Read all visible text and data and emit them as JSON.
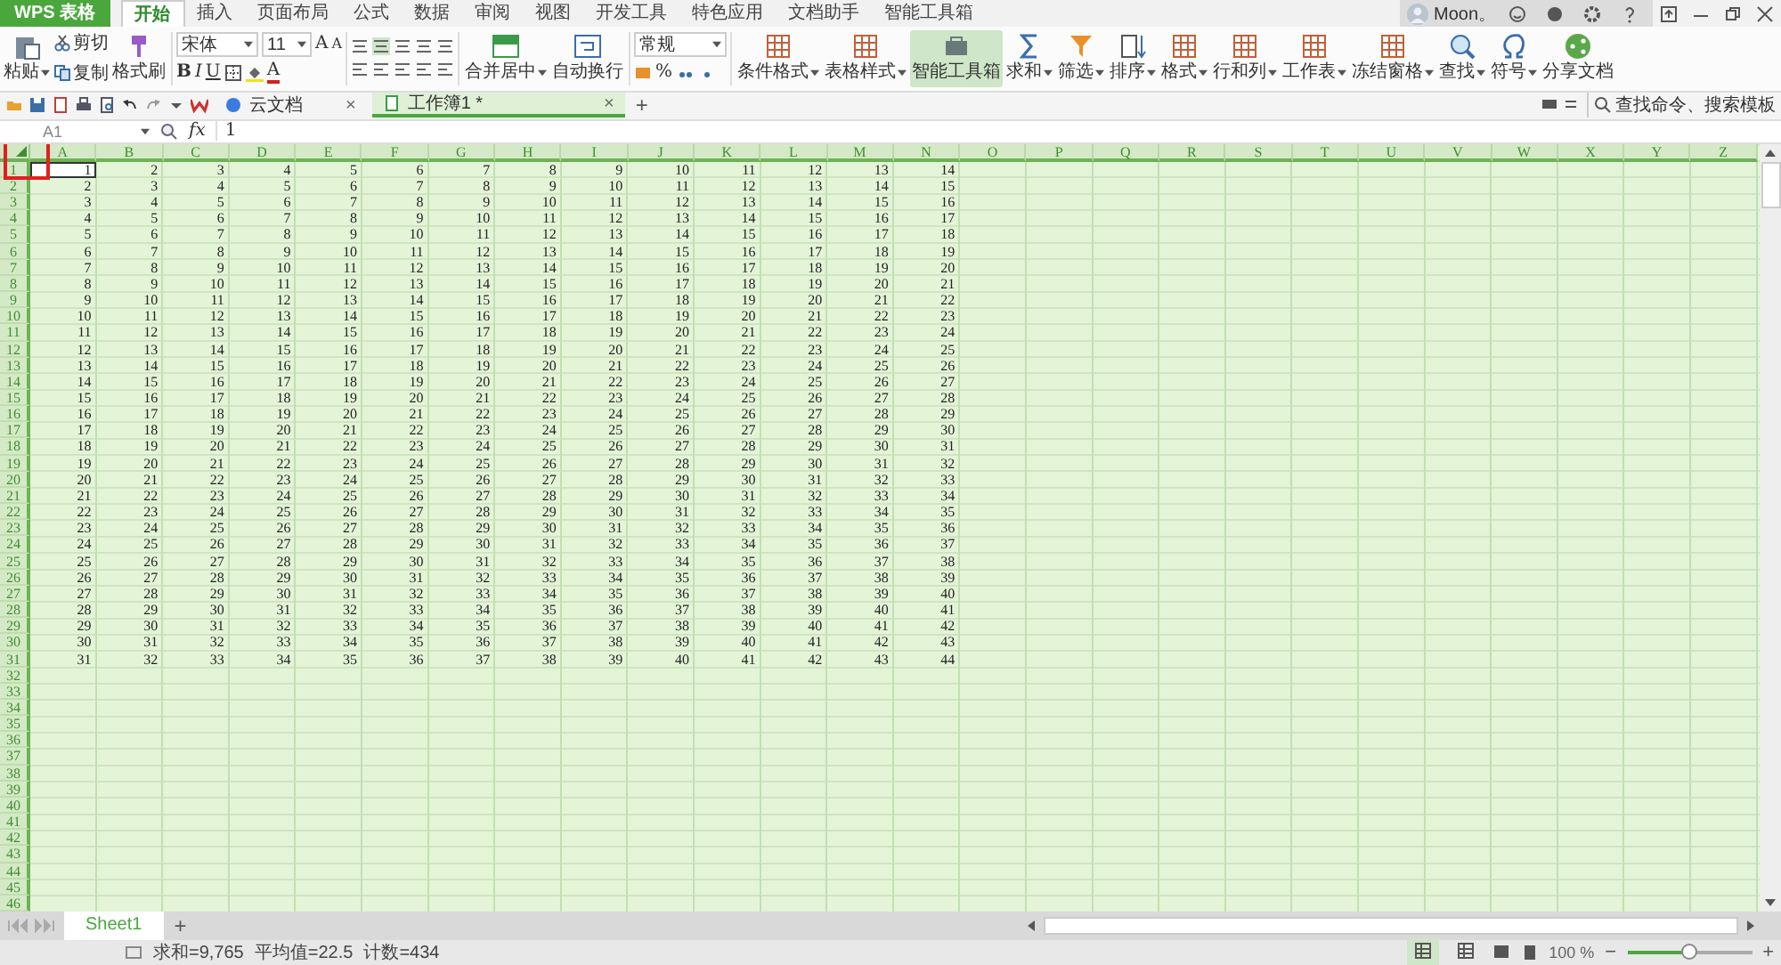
{
  "app_button": {
    "label": "WPS 表格"
  },
  "menu_tabs": [
    {
      "label": "开始",
      "selected": true
    },
    {
      "label": "插入",
      "selected": false
    },
    {
      "label": "页面布局",
      "selected": false
    },
    {
      "label": "公式",
      "selected": false
    },
    {
      "label": "数据",
      "selected": false
    },
    {
      "label": "审阅",
      "selected": false
    },
    {
      "label": "视图",
      "selected": false
    },
    {
      "label": "开发工具",
      "selected": false
    },
    {
      "label": "特色应用",
      "selected": false
    },
    {
      "label": "文档助手",
      "selected": false
    },
    {
      "label": "智能工具箱",
      "selected": false
    }
  ],
  "user": {
    "name": "Moon。"
  },
  "ribbon": {
    "paste": "粘贴",
    "cut": "剪切",
    "copy": "复制",
    "format_painter": "格式刷",
    "font": {
      "name": "宋体",
      "size": "11",
      "grow": "A",
      "shrink": "A",
      "bold": "B",
      "italic": "I",
      "underline": "U",
      "font_color": "A"
    },
    "merge": "合并居中",
    "wrap": "自动换行",
    "number_format": "常规",
    "percent": "%",
    "tools": [
      {
        "label": "条件格式",
        "dropdown": true,
        "selected": false
      },
      {
        "label": "表格样式",
        "dropdown": true,
        "selected": false
      },
      {
        "label": "智能工具箱",
        "dropdown": false,
        "selected": true
      },
      {
        "label": "求和",
        "dropdown": true,
        "selected": false
      },
      {
        "label": "筛选",
        "dropdown": true,
        "selected": false
      },
      {
        "label": "排序",
        "dropdown": true,
        "selected": false
      },
      {
        "label": "格式",
        "dropdown": true,
        "selected": false
      },
      {
        "label": "行和列",
        "dropdown": true,
        "selected": false
      },
      {
        "label": "工作表",
        "dropdown": true,
        "selected": false
      },
      {
        "label": "冻结窗格",
        "dropdown": true,
        "selected": false
      },
      {
        "label": "查找",
        "dropdown": true,
        "selected": false
      },
      {
        "label": "符号",
        "dropdown": true,
        "selected": false
      },
      {
        "label": "分享文档",
        "dropdown": false,
        "selected": false
      }
    ]
  },
  "doc_tabs": [
    {
      "label": "云文档",
      "close": "×",
      "selected": false
    },
    {
      "label": "工作簿1 *",
      "close": "×",
      "selected": true
    }
  ],
  "new_tab": "+",
  "command_search": "查找命令、搜索模板",
  "formula_bar": {
    "name_box": "A1",
    "fx": "fx",
    "value": "1"
  },
  "sheet": {
    "columns": [
      "A",
      "B",
      "C",
      "D",
      "E",
      "F",
      "G",
      "H",
      "I",
      "J",
      "K",
      "L",
      "M",
      "N",
      "O",
      "P",
      "Q",
      "R",
      "S",
      "T",
      "U",
      "V",
      "W",
      "X",
      "Y",
      "Z"
    ],
    "row_headers": [
      "1",
      "2",
      "3",
      "4",
      "5",
      "6",
      "7",
      "8",
      "9",
      "10",
      "11",
      "12",
      "13",
      "14",
      "15",
      "16",
      "17",
      "18",
      "19",
      "20",
      "21",
      "22",
      "23",
      "24",
      "25",
      "26",
      "27",
      "28",
      "29",
      "30",
      "31",
      "32",
      "33",
      "34",
      "35",
      "36",
      "37",
      "38",
      "39",
      "40",
      "41",
      "42",
      "43",
      "44",
      "45",
      "46"
    ],
    "rows": [
      [
        "1",
        "2",
        "3",
        "4",
        "5",
        "6",
        "7",
        "8",
        "9",
        "10",
        "11",
        "12",
        "13",
        "14"
      ],
      [
        "2",
        "3",
        "4",
        "5",
        "6",
        "7",
        "8",
        "9",
        "10",
        "11",
        "12",
        "13",
        "14",
        "15"
      ],
      [
        "3",
        "4",
        "5",
        "6",
        "7",
        "8",
        "9",
        "10",
        "11",
        "12",
        "13",
        "14",
        "15",
        "16"
      ],
      [
        "4",
        "5",
        "6",
        "7",
        "8",
        "9",
        "10",
        "11",
        "12",
        "13",
        "14",
        "15",
        "16",
        "17"
      ],
      [
        "5",
        "6",
        "7",
        "8",
        "9",
        "10",
        "11",
        "12",
        "13",
        "14",
        "15",
        "16",
        "17",
        "18"
      ],
      [
        "6",
        "7",
        "8",
        "9",
        "10",
        "11",
        "12",
        "13",
        "14",
        "15",
        "16",
        "17",
        "18",
        "19"
      ],
      [
        "7",
        "8",
        "9",
        "10",
        "11",
        "12",
        "13",
        "14",
        "15",
        "16",
        "17",
        "18",
        "19",
        "20"
      ],
      [
        "8",
        "9",
        "10",
        "11",
        "12",
        "13",
        "14",
        "15",
        "16",
        "17",
        "18",
        "19",
        "20",
        "21"
      ],
      [
        "9",
        "10",
        "11",
        "12",
        "13",
        "14",
        "15",
        "16",
        "17",
        "18",
        "19",
        "20",
        "21",
        "22"
      ],
      [
        "10",
        "11",
        "12",
        "13",
        "14",
        "15",
        "16",
        "17",
        "18",
        "19",
        "20",
        "21",
        "22",
        "23"
      ],
      [
        "11",
        "12",
        "13",
        "14",
        "15",
        "16",
        "17",
        "18",
        "19",
        "20",
        "21",
        "22",
        "23",
        "24"
      ],
      [
        "12",
        "13",
        "14",
        "15",
        "16",
        "17",
        "18",
        "19",
        "20",
        "21",
        "22",
        "23",
        "24",
        "25"
      ],
      [
        "13",
        "14",
        "15",
        "16",
        "17",
        "18",
        "19",
        "20",
        "21",
        "22",
        "23",
        "24",
        "25",
        "26"
      ],
      [
        "14",
        "15",
        "16",
        "17",
        "18",
        "19",
        "20",
        "21",
        "22",
        "23",
        "24",
        "25",
        "26",
        "27"
      ],
      [
        "15",
        "16",
        "17",
        "18",
        "19",
        "20",
        "21",
        "22",
        "23",
        "24",
        "25",
        "26",
        "27",
        "28"
      ],
      [
        "16",
        "17",
        "18",
        "19",
        "20",
        "21",
        "22",
        "23",
        "24",
        "25",
        "26",
        "27",
        "28",
        "29"
      ],
      [
        "17",
        "18",
        "19",
        "20",
        "21",
        "22",
        "23",
        "24",
        "25",
        "26",
        "27",
        "28",
        "29",
        "30"
      ],
      [
        "18",
        "19",
        "20",
        "21",
        "22",
        "23",
        "24",
        "25",
        "26",
        "27",
        "28",
        "29",
        "30",
        "31"
      ],
      [
        "19",
        "20",
        "21",
        "22",
        "23",
        "24",
        "25",
        "26",
        "27",
        "28",
        "29",
        "30",
        "31",
        "32"
      ],
      [
        "20",
        "21",
        "22",
        "23",
        "24",
        "25",
        "26",
        "27",
        "28",
        "29",
        "30",
        "31",
        "32",
        "33"
      ],
      [
        "21",
        "22",
        "23",
        "24",
        "25",
        "26",
        "27",
        "28",
        "29",
        "30",
        "31",
        "32",
        "33",
        "34"
      ],
      [
        "22",
        "23",
        "24",
        "25",
        "26",
        "27",
        "28",
        "29",
        "30",
        "31",
        "32",
        "33",
        "34",
        "35"
      ],
      [
        "23",
        "24",
        "25",
        "26",
        "27",
        "28",
        "29",
        "30",
        "31",
        "32",
        "33",
        "34",
        "35",
        "36"
      ],
      [
        "24",
        "25",
        "26",
        "27",
        "28",
        "29",
        "30",
        "31",
        "32",
        "33",
        "34",
        "35",
        "36",
        "37"
      ],
      [
        "25",
        "26",
        "27",
        "28",
        "29",
        "30",
        "31",
        "32",
        "33",
        "34",
        "35",
        "36",
        "37",
        "38"
      ],
      [
        "26",
        "27",
        "28",
        "29",
        "30",
        "31",
        "32",
        "33",
        "34",
        "35",
        "36",
        "37",
        "38",
        "39"
      ],
      [
        "27",
        "28",
        "29",
        "30",
        "31",
        "32",
        "33",
        "34",
        "35",
        "36",
        "37",
        "38",
        "39",
        "40"
      ],
      [
        "28",
        "29",
        "30",
        "31",
        "32",
        "33",
        "34",
        "35",
        "36",
        "37",
        "38",
        "39",
        "40",
        "41"
      ],
      [
        "29",
        "30",
        "31",
        "32",
        "33",
        "34",
        "35",
        "36",
        "37",
        "38",
        "39",
        "40",
        "41",
        "42"
      ],
      [
        "30",
        "31",
        "32",
        "33",
        "34",
        "35",
        "36",
        "37",
        "38",
        "39",
        "40",
        "41",
        "42",
        "43"
      ],
      [
        "31",
        "32",
        "33",
        "34",
        "35",
        "36",
        "37",
        "38",
        "39",
        "40",
        "41",
        "42",
        "43",
        "44"
      ]
    ]
  },
  "sheet_tabs": [
    {
      "label": "Sheet1",
      "selected": true
    }
  ],
  "add_sheet": "+",
  "status": {
    "sum": "求和=9,765",
    "average": "平均值=22.5",
    "count": "计数=434"
  },
  "view_modes": [
    {
      "selected": true
    },
    {
      "selected": false
    }
  ],
  "zoom": {
    "label": "100 %",
    "minus": "−",
    "plus": "+",
    "level": 0.5
  }
}
